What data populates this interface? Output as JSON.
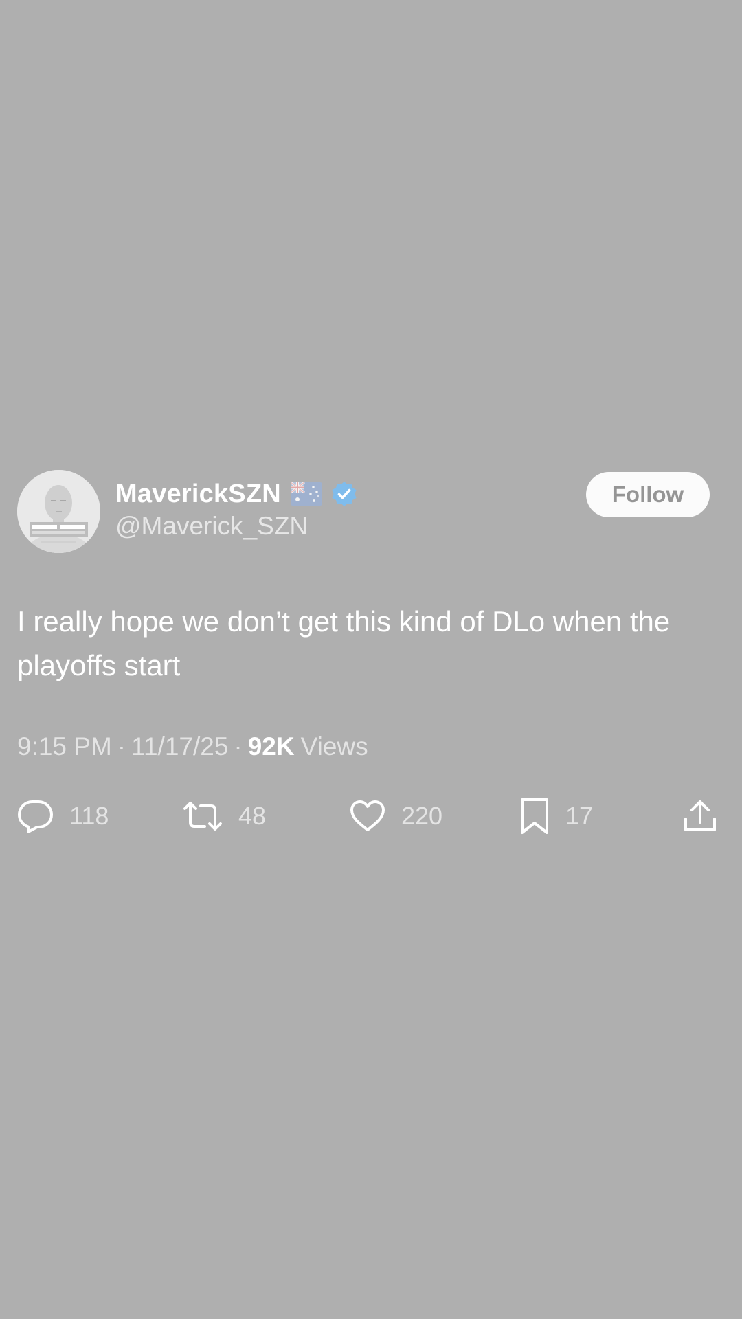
{
  "tweet": {
    "display_name": "MaverickSZN",
    "flag_icon": "australia-flag-icon",
    "verified_icon": "verified-badge-icon",
    "handle": "@Maverick_SZN",
    "follow_label": "Follow",
    "text": "I really hope we don’t get this kind of DLo when the playoffs start",
    "time": "9:15 PM",
    "date": "11/17/25",
    "separator": "·",
    "views_count": "92K",
    "views_label": "Views"
  },
  "actions": {
    "reply": {
      "icon": "reply-icon",
      "count": "118"
    },
    "retweet": {
      "icon": "retweet-icon",
      "count": "48"
    },
    "like": {
      "icon": "heart-icon",
      "count": "220"
    },
    "bookmark": {
      "icon": "bookmark-icon",
      "count": "17"
    },
    "share": {
      "icon": "share-icon"
    }
  },
  "colors": {
    "background": "#afafaf",
    "text": "#ffffff",
    "muted_text": "#e4e4e4",
    "follow_button_bg": "#fbfbfb",
    "follow_button_text": "#959595",
    "verified_blue": "#4aa3ea"
  }
}
